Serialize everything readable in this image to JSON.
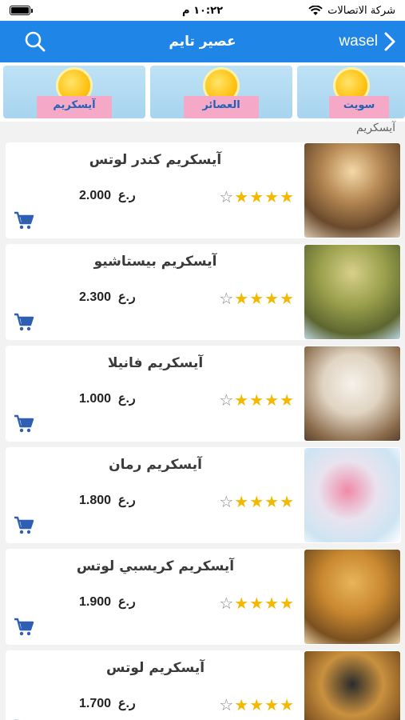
{
  "status": {
    "carrier": "شركة الاتصالات",
    "time": "١٠:٢٢ م"
  },
  "nav": {
    "title": "عصير تايم",
    "back_label": "wasel"
  },
  "categories": [
    {
      "label": "آيسكريم"
    },
    {
      "label": "العصائر"
    },
    {
      "label": "سويت"
    }
  ],
  "section": {
    "label": "آيسكريم"
  },
  "products": [
    {
      "name": "آيسكريم كندر لوتس",
      "price": "2.000",
      "currency": "ر.ع",
      "rating": 4
    },
    {
      "name": "آيسكريم بيستاشيو",
      "price": "2.300",
      "currency": "ر.ع",
      "rating": 4
    },
    {
      "name": "آيسكريم فانيلا",
      "price": "1.000",
      "currency": "ر.ع",
      "rating": 4
    },
    {
      "name": "آيسكريم رمان",
      "price": "1.800",
      "currency": "ر.ع",
      "rating": 4
    },
    {
      "name": "آيسكريم كريسبي لوتس",
      "price": "1.900",
      "currency": "ر.ع",
      "rating": 4
    },
    {
      "name": "آيسكريم لوتس",
      "price": "1.700",
      "currency": "ر.ع",
      "rating": 4
    }
  ],
  "colors": {
    "accent": "#1f86e8",
    "star": "#f5b800",
    "cart": "#2f5fb3"
  },
  "icons": {
    "search": "search-icon",
    "back": "chevron-right-icon",
    "cart": "cart-icon",
    "wifi": "wifi-icon",
    "battery": "battery-icon"
  }
}
